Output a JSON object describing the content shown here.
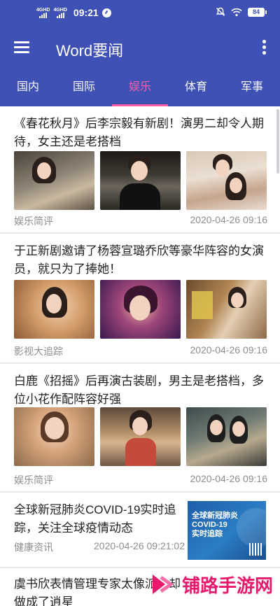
{
  "status_bar": {
    "network_1": "4GHD",
    "network_2": "4GHD",
    "time": "09:21",
    "battery": "84"
  },
  "app_bar": {
    "title": "Word要闻"
  },
  "tabs": [
    {
      "label": "国内",
      "active": false
    },
    {
      "label": "国际",
      "active": false
    },
    {
      "label": "娱乐",
      "active": true
    },
    {
      "label": "体育",
      "active": false
    },
    {
      "label": "军事",
      "active": false
    }
  ],
  "colors": {
    "primary": "#3f51b5",
    "accent": "#ff5fa8"
  },
  "articles": [
    {
      "title": "《春花秋月》后李宗毅有新剧！演男二却令人期待，女主还是老搭档",
      "source": "娱乐简评",
      "time": "2020-04-26 09:16",
      "images": 3
    },
    {
      "title": "于正新剧邀请了杨蓉宣璐乔欣等豪华阵容的女演员，就只为了捧她！",
      "source": "影视大追踪",
      "time": "2020-04-26 09:16",
      "images": 3
    },
    {
      "title": "白鹿《招摇》后再演古装剧，男主是老搭档，多位小花作配阵容好强",
      "source": "娱乐简评",
      "time": "2020-04-26 09:16",
      "images": 3
    },
    {
      "title": "全球新冠肺炎COVID-19实时追踪，关注全球疫情动态",
      "source": "健康资讯",
      "time": "2020-04-26 09:21:02",
      "image_text_1": "全球新冠肺炎",
      "image_text_2": "COVID-19",
      "image_text_3": "实时追踪"
    },
    {
      "title": "虞书欣表情管理专家太像派，却做成了逍星"
    }
  ],
  "watermark": {
    "text": "铺路手游网"
  }
}
